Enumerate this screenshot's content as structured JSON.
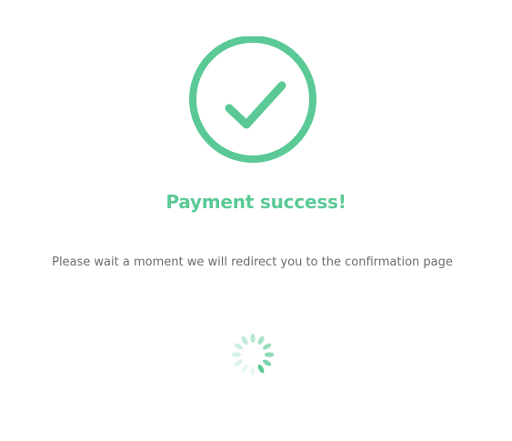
{
  "colors": {
    "accent": "#5ac996",
    "text": "#6b6b6b",
    "background": "#ffffff"
  },
  "status": {
    "icon": "check-circle-icon",
    "title": "Payment success!",
    "message": "Please wait a moment we will redirect you to the confirmation page"
  },
  "loader": {
    "icon": "loading-spinner-icon"
  }
}
